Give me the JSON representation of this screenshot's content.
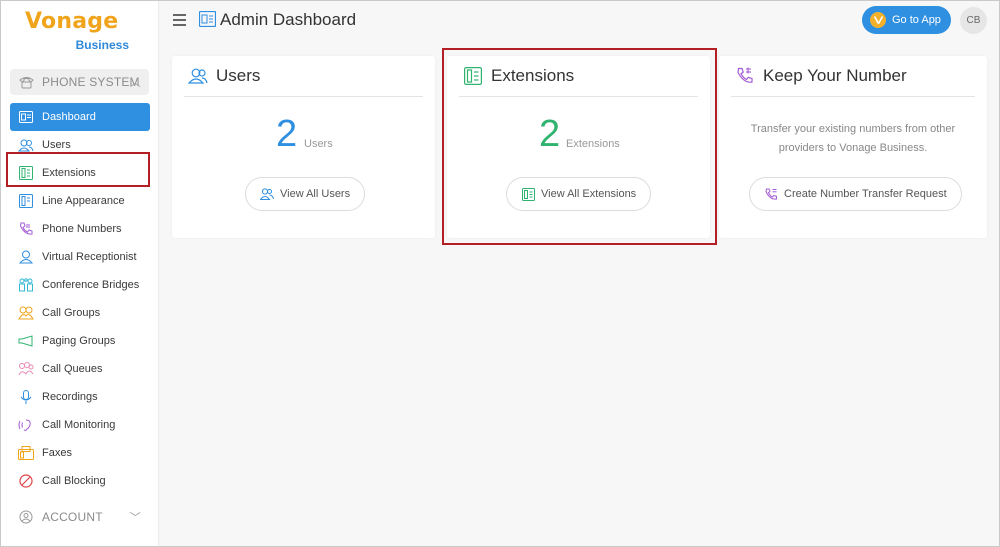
{
  "brand": {
    "logo_word": "Vonage",
    "logo_sub": "Business",
    "accent": "#2f8fe0",
    "logo_color": "#f0a41c"
  },
  "sidebar": {
    "phone_section": "PHONE SYSTEM",
    "items": [
      {
        "label": "Dashboard",
        "icon": "dashboard-icon",
        "color": "#ffffff"
      },
      {
        "label": "Users",
        "icon": "users-icon",
        "color": "#2f8fe0"
      },
      {
        "label": "Extensions",
        "icon": "extensions-icon",
        "color": "#2fb36f"
      },
      {
        "label": "Line Appearance",
        "icon": "line-appearance-icon",
        "color": "#2f8fe0"
      },
      {
        "label": "Phone Numbers",
        "icon": "phone-numbers-icon",
        "color": "#a35ad6"
      },
      {
        "label": "Virtual Receptionist",
        "icon": "virtual-receptionist-icon",
        "color": "#2f8fe0"
      },
      {
        "label": "Conference Bridges",
        "icon": "conference-bridges-icon",
        "color": "#32b8d6"
      },
      {
        "label": "Call Groups",
        "icon": "call-groups-icon",
        "color": "#f0a41c"
      },
      {
        "label": "Paging Groups",
        "icon": "paging-groups-icon",
        "color": "#2fb36f"
      },
      {
        "label": "Call Queues",
        "icon": "call-queues-icon",
        "color": "#e98bb6"
      },
      {
        "label": "Recordings",
        "icon": "recordings-icon",
        "color": "#2f8fe0"
      },
      {
        "label": "Call Monitoring",
        "icon": "call-monitoring-icon",
        "color": "#a35ad6"
      },
      {
        "label": "Faxes",
        "icon": "faxes-icon",
        "color": "#f0a41c"
      },
      {
        "label": "Call Blocking",
        "icon": "call-blocking-icon",
        "color": "#e0454a"
      }
    ],
    "account_section": "ACCOUNT"
  },
  "header": {
    "title": "Admin Dashboard",
    "go_to_app": "Go to App",
    "avatar_initials": "CB"
  },
  "cards": {
    "users": {
      "title": "Users",
      "count": "2",
      "count_label": "Users",
      "button": "View All Users",
      "color": "#2f8fe0"
    },
    "extensions": {
      "title": "Extensions",
      "count": "2",
      "count_label": "Extensions",
      "button": "View All Extensions",
      "color": "#2fb36f"
    },
    "keep_number": {
      "title": "Keep Your Number",
      "description": "Transfer your existing numbers from other providers to Vonage Business.",
      "button": "Create Number Transfer Request",
      "color": "#a35ad6"
    }
  },
  "highlight_color": "#b21f24"
}
